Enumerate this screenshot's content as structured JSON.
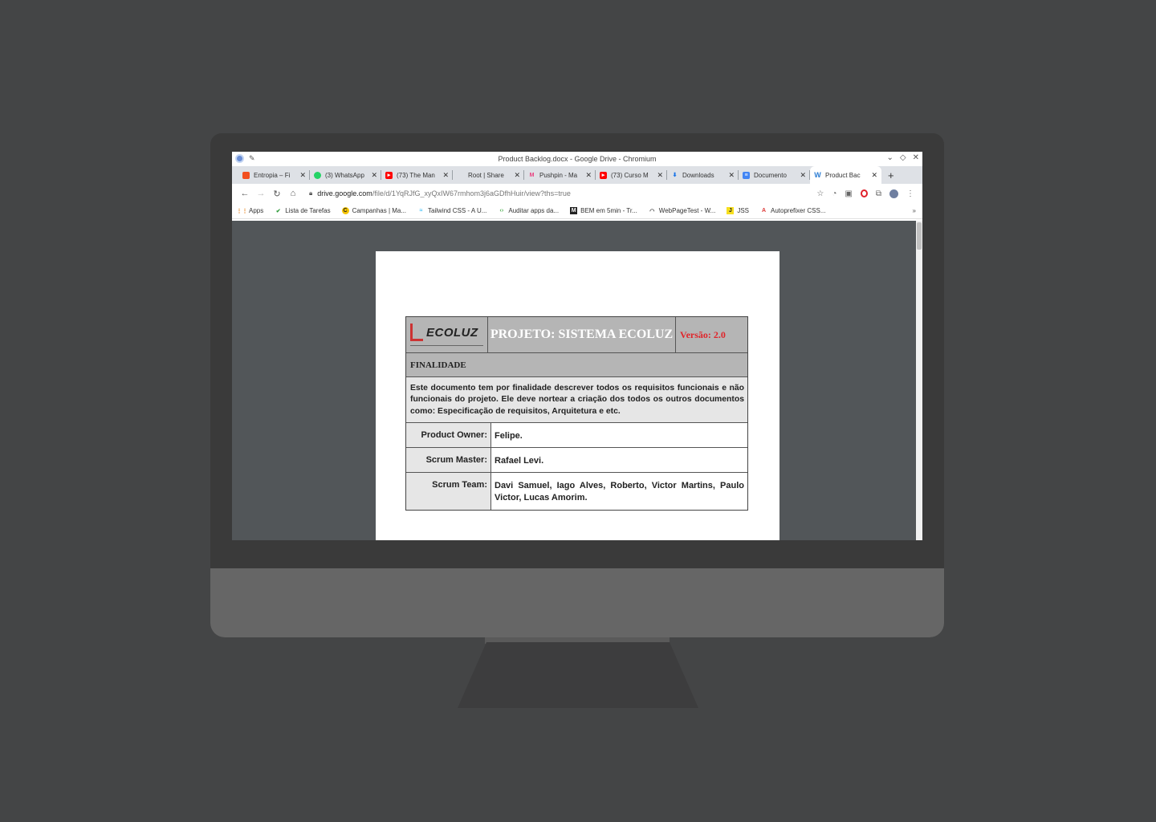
{
  "window": {
    "title": "Product Backlog.docx - Google Drive - Chromium"
  },
  "tabs": [
    {
      "label": "Entropia – Fi",
      "icon": "figma-icon",
      "color": "#f24e1e"
    },
    {
      "label": "(3) WhatsApp",
      "icon": "whatsapp-icon",
      "color": "#25d366"
    },
    {
      "label": "(73) The Man",
      "icon": "youtube-icon",
      "color": "#ff0000"
    },
    {
      "label": "Root | Share",
      "icon": "blank-icon",
      "color": "#dee1e6"
    },
    {
      "label": "Pushpin - Ma",
      "icon": "pushpin-icon",
      "color": "#e8417f"
    },
    {
      "label": "(73) Curso M",
      "icon": "youtube-icon",
      "color": "#ff0000"
    },
    {
      "label": "Downloads",
      "icon": "download-icon",
      "color": "#1a73e8"
    },
    {
      "label": "Documento",
      "icon": "docs-icon",
      "color": "#4285f4"
    },
    {
      "label": "Product Bac",
      "icon": "word-icon",
      "color": "#2b7cd3"
    }
  ],
  "address": {
    "host": "drive.google.com",
    "path": "/file/d/1YqRJfG_xyQxIW67rmhom3j6aGDfhHuir/view?ths=true"
  },
  "bookmarks": [
    {
      "label": "Apps",
      "icon": "apps-grid-icon"
    },
    {
      "label": "Lista de Tarefas",
      "icon": "check-icon"
    },
    {
      "label": "Campanhas | Ma...",
      "icon": "campaign-icon"
    },
    {
      "label": "Tailwind CSS - A U...",
      "icon": "tailwind-icon"
    },
    {
      "label": "Auditar apps da...",
      "icon": "code-icon"
    },
    {
      "label": "BEM em 5min - Tr...",
      "icon": "medium-icon"
    },
    {
      "label": "WebPageTest - W...",
      "icon": "gauge-icon"
    },
    {
      "label": "JSS",
      "icon": "jss-icon"
    },
    {
      "label": "Autoprefixer CSS...",
      "icon": "autoprefixer-icon"
    }
  ],
  "bookmarks_more": "»",
  "document": {
    "logo": "ECOLUZ",
    "logo_mark": "®",
    "project": "PROJETO: SISTEMA ECOLUZ",
    "version": "Versão: 2.0",
    "section": "FINALIDADE",
    "description": "Este documento tem por finalidade descrever todos os requisitos funcionais e não funcionais do projeto. Ele deve nortear a criação dos todos os outros documentos como: Especificação de requisitos, Arquitetura e etc.",
    "fields": [
      {
        "label": "Product Owner:",
        "value": "Felipe."
      },
      {
        "label": "Scrum Master:",
        "value": "Rafael Levi."
      },
      {
        "label": "Scrum Team:",
        "value": "Davi Samuel, Iago Alves, Roberto, Victor Martins, Paulo Victor, Lucas Amorim."
      }
    ]
  },
  "colors": {
    "version_red": "#e0242a",
    "header_gray": "#b5b5b5",
    "viewer_bg": "#525659"
  }
}
